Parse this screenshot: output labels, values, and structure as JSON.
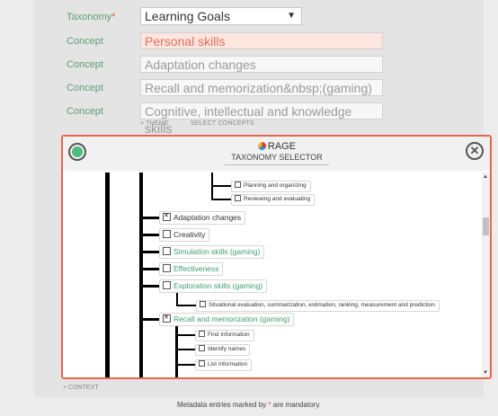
{
  "form": {
    "taxonomy_label": "Taxonomy",
    "required_mark": "*",
    "taxonomy_value": "Learning Goals",
    "concept_label": "Concept",
    "concepts": [
      "Personal skills",
      "Adaptation changes",
      "Recall and memorization&nbsp;(gaming)",
      "Cognitive, intellectual and knowledge skills"
    ],
    "add_theme": "+ THEME",
    "select_concepts": "SELECT CONCEPTS",
    "add_context": "+ CONTEXT"
  },
  "selector": {
    "brand": "RAGE",
    "title": "TAXONOMY SELECTOR",
    "nodes": [
      {
        "label": "Planning and organizing",
        "checked": false
      },
      {
        "label": "Reviewing and evaluating",
        "checked": false
      },
      {
        "label": "Adaptation changes",
        "checked": true
      },
      {
        "label": "Creativity",
        "checked": false
      },
      {
        "label": "Simulation skills (gaming)",
        "checked": false
      },
      {
        "label": "Effectiveness",
        "checked": false
      },
      {
        "label": "Exploration skills (gaming)",
        "checked": false
      },
      {
        "label": "Situational evaluation, summarization, estimation, ranking, measurement and prediction",
        "checked": false
      },
      {
        "label": "Recall and memorization (gaming)",
        "checked": true
      },
      {
        "label": "Find information",
        "checked": false
      },
      {
        "label": "Identify names",
        "checked": false
      },
      {
        "label": "List information",
        "checked": false
      }
    ]
  },
  "footer": {
    "text_before": "Metadata entries marked by ",
    "star": "*",
    "text_after": " are mandatory."
  }
}
